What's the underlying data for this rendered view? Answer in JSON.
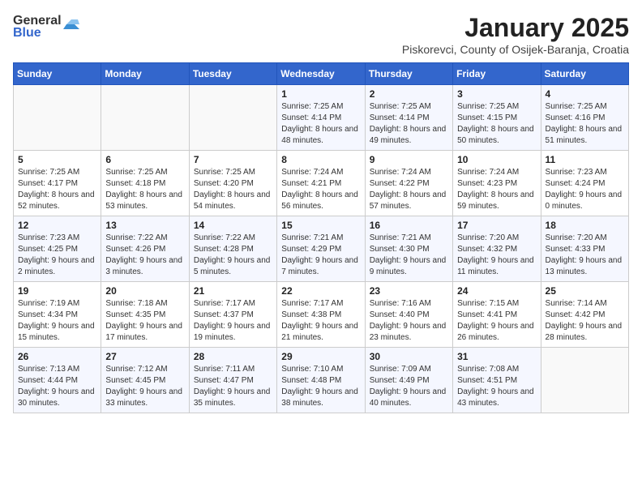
{
  "header": {
    "logo_general": "General",
    "logo_blue": "Blue",
    "title": "January 2025",
    "subtitle": "Piskorevci, County of Osijek-Baranja, Croatia"
  },
  "weekdays": [
    "Sunday",
    "Monday",
    "Tuesday",
    "Wednesday",
    "Thursday",
    "Friday",
    "Saturday"
  ],
  "weeks": [
    [
      {
        "day": "",
        "sunrise": "",
        "sunset": "",
        "daylight": ""
      },
      {
        "day": "",
        "sunrise": "",
        "sunset": "",
        "daylight": ""
      },
      {
        "day": "",
        "sunrise": "",
        "sunset": "",
        "daylight": ""
      },
      {
        "day": "1",
        "sunrise": "7:25 AM",
        "sunset": "4:14 PM",
        "daylight": "8 hours and 48 minutes."
      },
      {
        "day": "2",
        "sunrise": "7:25 AM",
        "sunset": "4:14 PM",
        "daylight": "8 hours and 49 minutes."
      },
      {
        "day": "3",
        "sunrise": "7:25 AM",
        "sunset": "4:15 PM",
        "daylight": "8 hours and 50 minutes."
      },
      {
        "day": "4",
        "sunrise": "7:25 AM",
        "sunset": "4:16 PM",
        "daylight": "8 hours and 51 minutes."
      }
    ],
    [
      {
        "day": "5",
        "sunrise": "7:25 AM",
        "sunset": "4:17 PM",
        "daylight": "8 hours and 52 minutes."
      },
      {
        "day": "6",
        "sunrise": "7:25 AM",
        "sunset": "4:18 PM",
        "daylight": "8 hours and 53 minutes."
      },
      {
        "day": "7",
        "sunrise": "7:25 AM",
        "sunset": "4:20 PM",
        "daylight": "8 hours and 54 minutes."
      },
      {
        "day": "8",
        "sunrise": "7:24 AM",
        "sunset": "4:21 PM",
        "daylight": "8 hours and 56 minutes."
      },
      {
        "day": "9",
        "sunrise": "7:24 AM",
        "sunset": "4:22 PM",
        "daylight": "8 hours and 57 minutes."
      },
      {
        "day": "10",
        "sunrise": "7:24 AM",
        "sunset": "4:23 PM",
        "daylight": "8 hours and 59 minutes."
      },
      {
        "day": "11",
        "sunrise": "7:23 AM",
        "sunset": "4:24 PM",
        "daylight": "9 hours and 0 minutes."
      }
    ],
    [
      {
        "day": "12",
        "sunrise": "7:23 AM",
        "sunset": "4:25 PM",
        "daylight": "9 hours and 2 minutes."
      },
      {
        "day": "13",
        "sunrise": "7:22 AM",
        "sunset": "4:26 PM",
        "daylight": "9 hours and 3 minutes."
      },
      {
        "day": "14",
        "sunrise": "7:22 AM",
        "sunset": "4:28 PM",
        "daylight": "9 hours and 5 minutes."
      },
      {
        "day": "15",
        "sunrise": "7:21 AM",
        "sunset": "4:29 PM",
        "daylight": "9 hours and 7 minutes."
      },
      {
        "day": "16",
        "sunrise": "7:21 AM",
        "sunset": "4:30 PM",
        "daylight": "9 hours and 9 minutes."
      },
      {
        "day": "17",
        "sunrise": "7:20 AM",
        "sunset": "4:32 PM",
        "daylight": "9 hours and 11 minutes."
      },
      {
        "day": "18",
        "sunrise": "7:20 AM",
        "sunset": "4:33 PM",
        "daylight": "9 hours and 13 minutes."
      }
    ],
    [
      {
        "day": "19",
        "sunrise": "7:19 AM",
        "sunset": "4:34 PM",
        "daylight": "9 hours and 15 minutes."
      },
      {
        "day": "20",
        "sunrise": "7:18 AM",
        "sunset": "4:35 PM",
        "daylight": "9 hours and 17 minutes."
      },
      {
        "day": "21",
        "sunrise": "7:17 AM",
        "sunset": "4:37 PM",
        "daylight": "9 hours and 19 minutes."
      },
      {
        "day": "22",
        "sunrise": "7:17 AM",
        "sunset": "4:38 PM",
        "daylight": "9 hours and 21 minutes."
      },
      {
        "day": "23",
        "sunrise": "7:16 AM",
        "sunset": "4:40 PM",
        "daylight": "9 hours and 23 minutes."
      },
      {
        "day": "24",
        "sunrise": "7:15 AM",
        "sunset": "4:41 PM",
        "daylight": "9 hours and 26 minutes."
      },
      {
        "day": "25",
        "sunrise": "7:14 AM",
        "sunset": "4:42 PM",
        "daylight": "9 hours and 28 minutes."
      }
    ],
    [
      {
        "day": "26",
        "sunrise": "7:13 AM",
        "sunset": "4:44 PM",
        "daylight": "9 hours and 30 minutes."
      },
      {
        "day": "27",
        "sunrise": "7:12 AM",
        "sunset": "4:45 PM",
        "daylight": "9 hours and 33 minutes."
      },
      {
        "day": "28",
        "sunrise": "7:11 AM",
        "sunset": "4:47 PM",
        "daylight": "9 hours and 35 minutes."
      },
      {
        "day": "29",
        "sunrise": "7:10 AM",
        "sunset": "4:48 PM",
        "daylight": "9 hours and 38 minutes."
      },
      {
        "day": "30",
        "sunrise": "7:09 AM",
        "sunset": "4:49 PM",
        "daylight": "9 hours and 40 minutes."
      },
      {
        "day": "31",
        "sunrise": "7:08 AM",
        "sunset": "4:51 PM",
        "daylight": "9 hours and 43 minutes."
      },
      {
        "day": "",
        "sunrise": "",
        "sunset": "",
        "daylight": ""
      }
    ]
  ]
}
